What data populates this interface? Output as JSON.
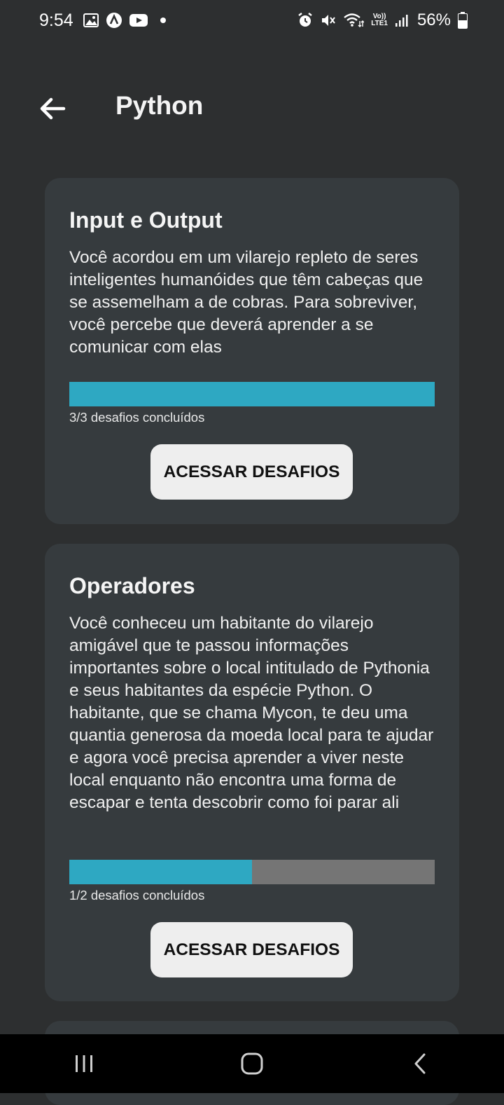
{
  "status_bar": {
    "time": "9:54",
    "battery_percent": "56%",
    "volte_label_top": "Vo))",
    "volte_label_bottom": "LTE1",
    "left_icons": [
      "gallery-icon",
      "app-a-icon",
      "youtube-icon",
      "notification-dot"
    ],
    "right_icons": [
      "alarm-icon",
      "mute-icon",
      "wifi-icon",
      "volte-icon",
      "signal-icon",
      "battery-icon"
    ]
  },
  "header": {
    "title": "Python",
    "back_icon": "arrow-left-icon"
  },
  "modules": [
    {
      "title": "Input e Output",
      "description": "Você acordou em um vilarejo repleto de seres inteligentes humanóides que têm cabeças que se assemelham a de cobras. Para sobreviver, você percebe que deverá aprender a se comunicar com elas",
      "progress_fraction": 1.0,
      "progress_label": "3/3 desafios concluídos",
      "button_label": "ACESSAR DESAFIOS"
    },
    {
      "title": "Operadores",
      "description": "Você conheceu um habitante do vilarejo amigável que te passou informações importantes sobre o local intitulado de Pythonia e seus habitantes da espécie Python. O habitante, que se chama Mycon, te deu uma quantia generosa da moeda local para te ajudar e agora você precisa aprender a viver neste local enquanto não encontra uma forma de escapar e tenta descobrir como foi parar ali",
      "progress_fraction": 0.5,
      "progress_label": "1/2 desafios concluídos",
      "button_label": "ACESSAR DESAFIOS"
    }
  ],
  "colors": {
    "background": "#2d2f30",
    "card": "#363b3e",
    "progress_fill": "#2ea8c2",
    "progress_track": "#757575",
    "button": "#eeeeee"
  },
  "nav_bar": {
    "icons": [
      "recent-apps-icon",
      "home-icon",
      "back-nav-icon"
    ]
  }
}
